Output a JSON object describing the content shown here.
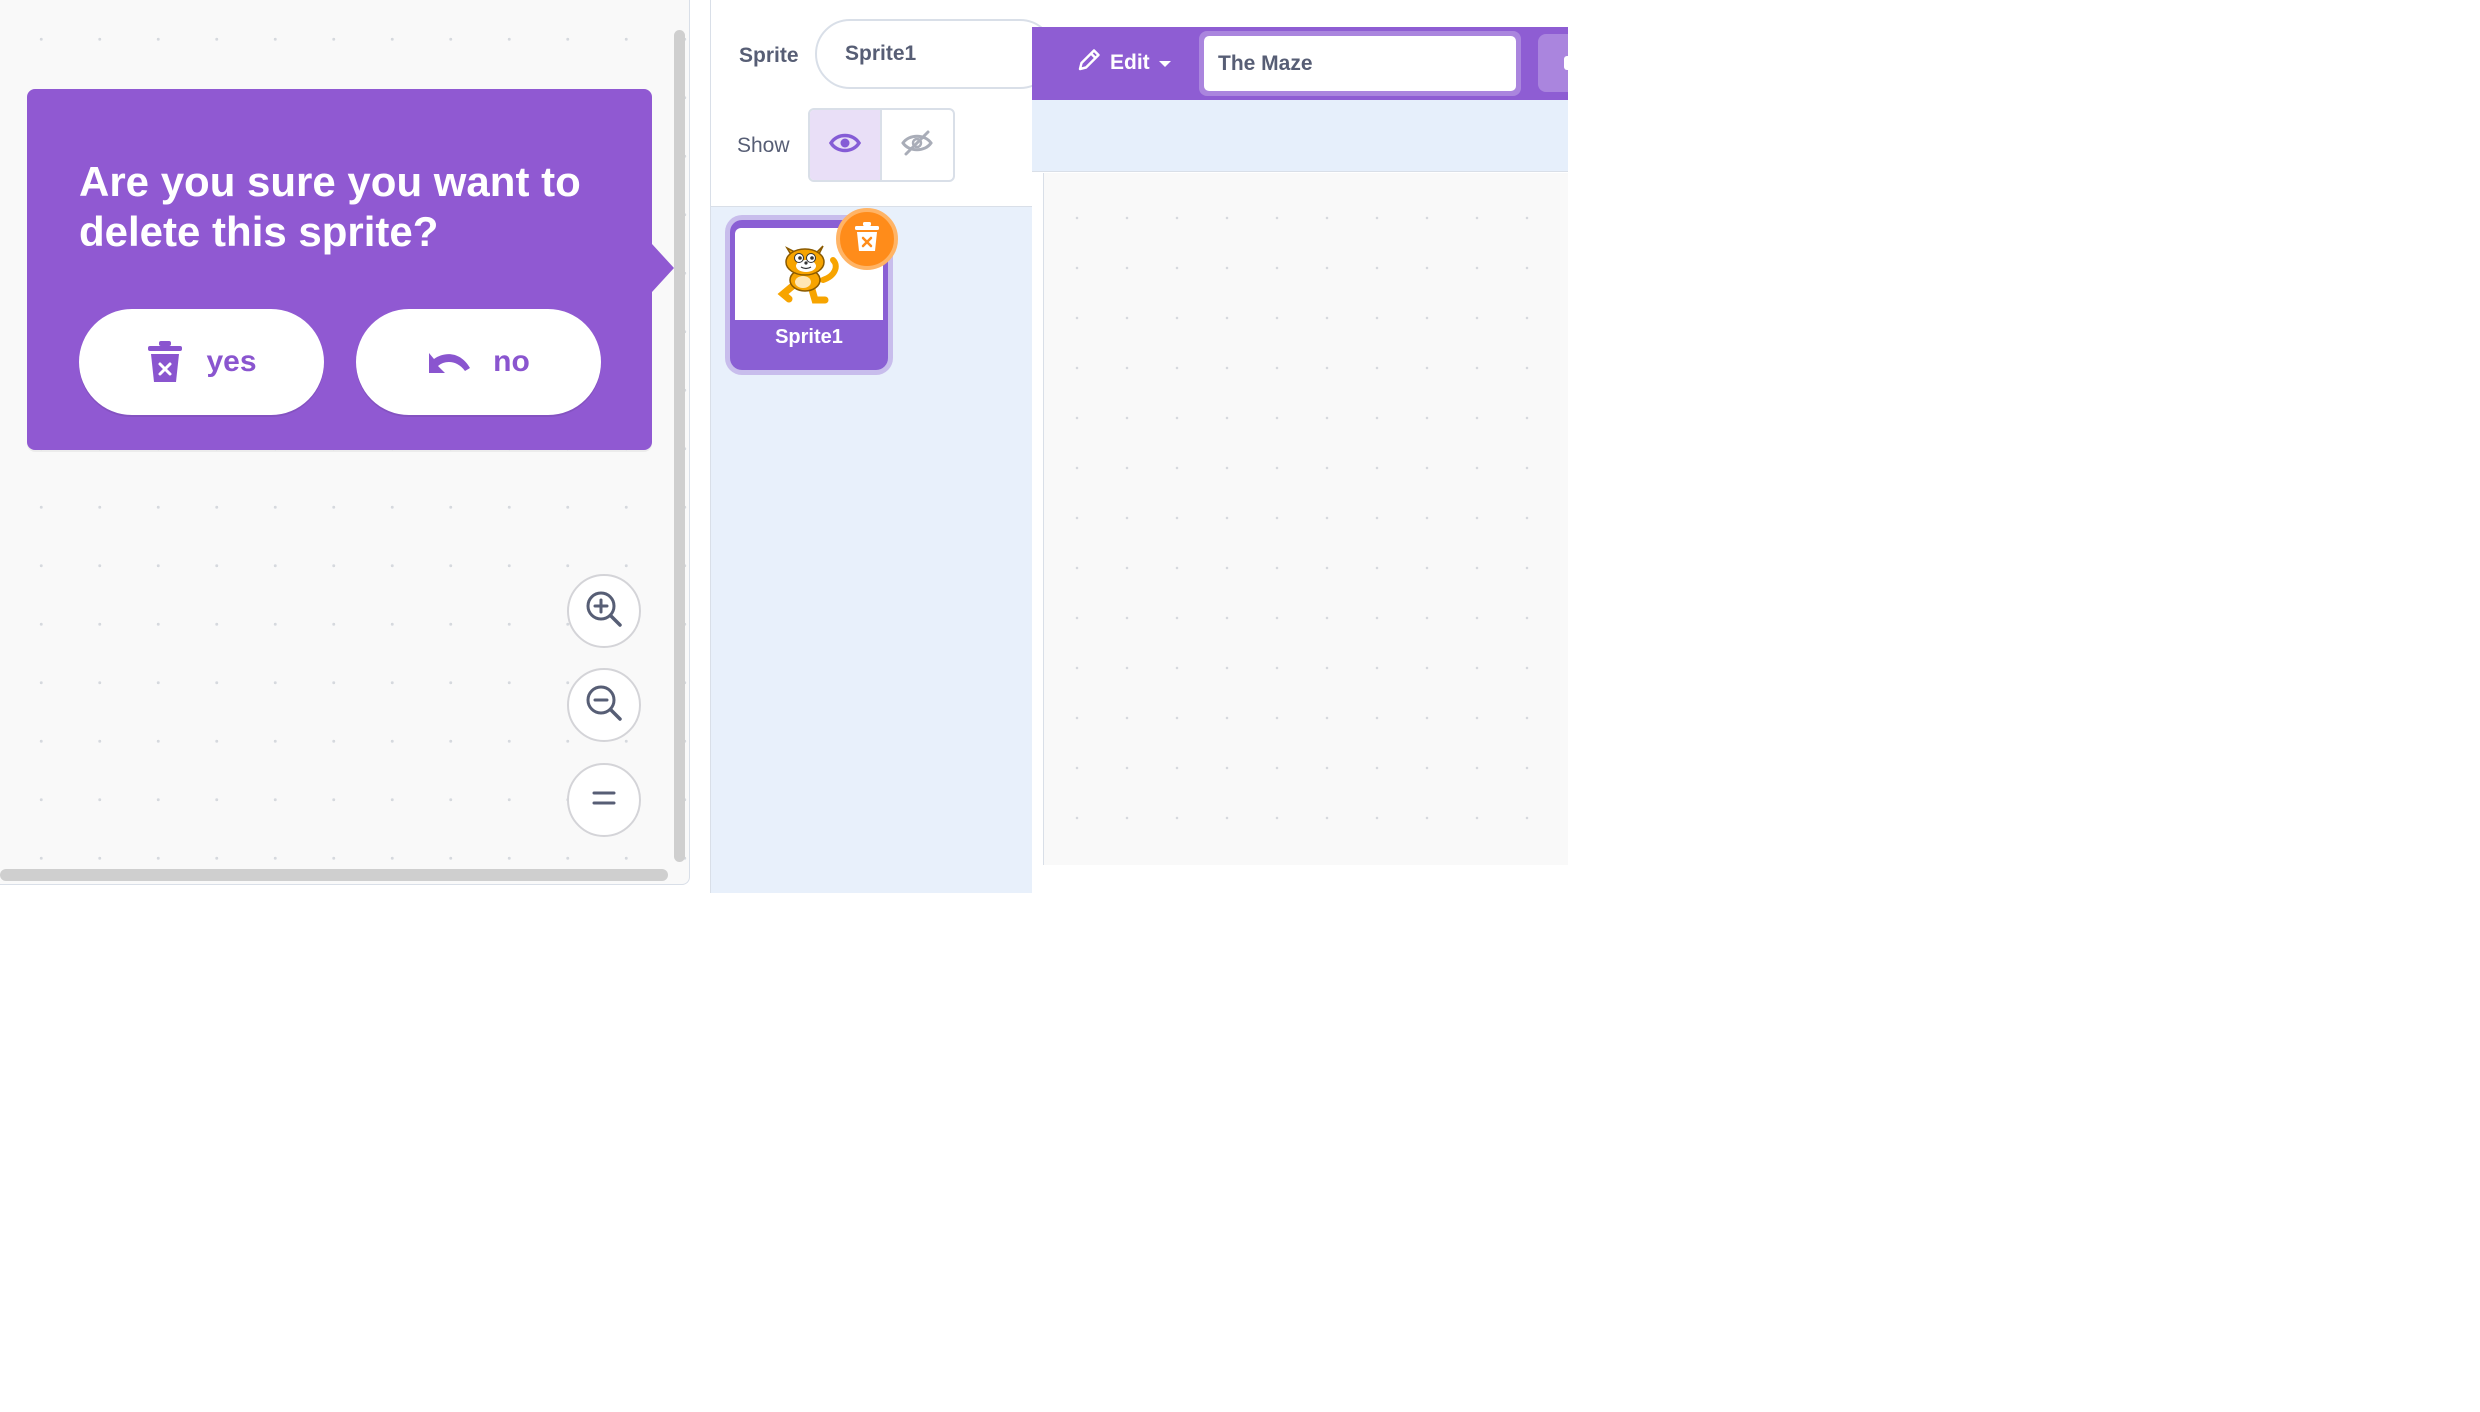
{
  "dialog": {
    "message": "Are you sure you want to delete this sprite?",
    "yes_label": "yes",
    "no_label": "no"
  },
  "zoom": {
    "zoom_in_icon": "zoom-in-icon",
    "zoom_out_icon": "zoom-out-icon",
    "reset_icon": "equals-icon"
  },
  "sprite_info": {
    "sprite_label": "Sprite",
    "sprite_name": "Sprite1",
    "show_label": "Show",
    "visible": true
  },
  "sprite_list": [
    {
      "name": "Sprite1",
      "selected": true,
      "icon": "cat-sprite-icon"
    }
  ],
  "menu_bar": {
    "edit_label": "Edit",
    "project_title": "The Maze"
  },
  "colors": {
    "scratch_purple": "#8e5dd3",
    "dialog_purple": "#9059d2",
    "delete_orange": "#ff8c1a",
    "text_gray": "#575e75"
  }
}
